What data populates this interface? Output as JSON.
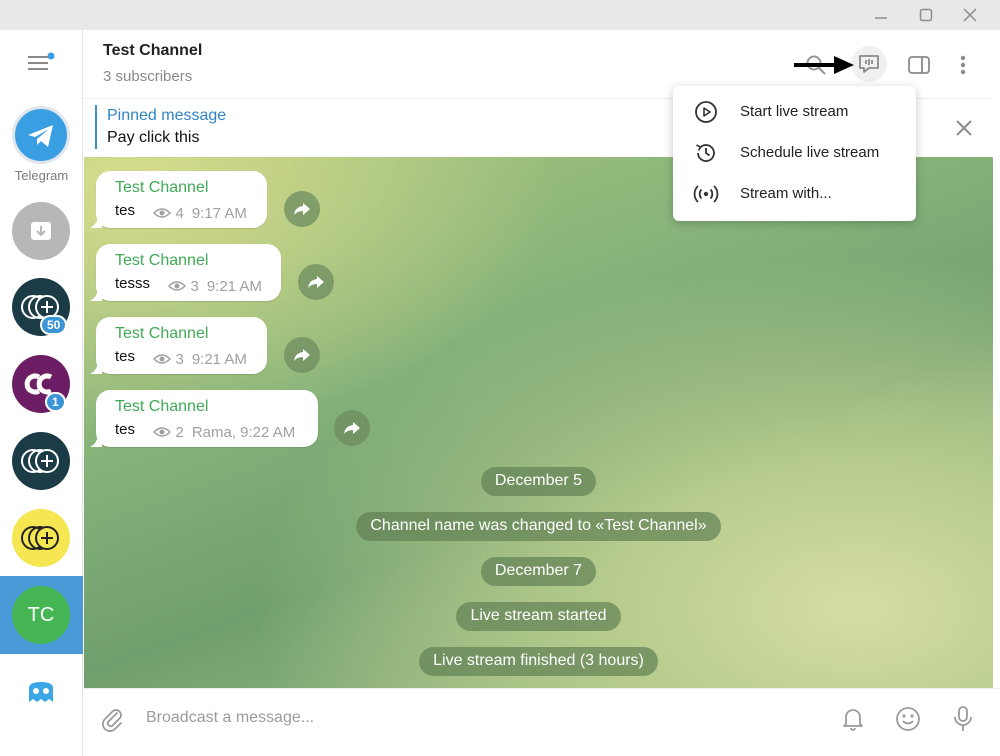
{
  "window": {
    "controls": [
      "minimize-icon",
      "maximize-icon",
      "close-icon"
    ]
  },
  "sidebar": {
    "menu_icon": "hamburger-menu-icon",
    "folders": [
      {
        "label": "Telegram",
        "icon": "telegram-logo",
        "color": "#3a9ee3"
      },
      {
        "icon": "archive-icon",
        "color": "#b7b7b7"
      },
      {
        "icon": "coins-plus-icon",
        "color": "#1b3b47",
        "badge": "50"
      },
      {
        "icon": "cc-logo",
        "color": "#6b1e63",
        "badge": "1"
      },
      {
        "icon": "coins-plus-icon",
        "color": "#1b3b47"
      },
      {
        "icon": "coins-plus-icon",
        "color": "#f5e652"
      },
      {
        "initials": "TC",
        "color": "#46b553",
        "active": true
      },
      {
        "icon": "ghost-icon",
        "color": "#3aa6e6"
      }
    ]
  },
  "header": {
    "title": "Test Channel",
    "subtitle": "3 subscribers",
    "icons": [
      "search-icon",
      "live-stream-icon",
      "sidebar-toggle-icon",
      "more-icon"
    ]
  },
  "pinned": {
    "title": "Pinned message",
    "text": "Pay click this"
  },
  "messages": [
    {
      "author": "Test Channel",
      "text": "tes",
      "views": "4",
      "time": "9:17 AM"
    },
    {
      "author": "Test Channel",
      "text": "tesss",
      "views": "3",
      "time": "9:21 AM"
    },
    {
      "author": "Test Channel",
      "text": "tes",
      "views": "3",
      "time": "9:21 AM"
    },
    {
      "author": "Test Channel",
      "text": "tes",
      "views": "2",
      "time": "Rama, 9:22 AM"
    }
  ],
  "service_messages": [
    "December 5",
    "Channel name was changed to «Test Channel»",
    "December 7",
    "Live stream started",
    "Live stream finished (3 hours)"
  ],
  "popup_menu": {
    "items": [
      {
        "label": "Start live stream",
        "icon": "play-circle-icon"
      },
      {
        "label": "Schedule live stream",
        "icon": "clock-history-icon"
      },
      {
        "label": "Stream with...",
        "icon": "broadcast-icon"
      }
    ]
  },
  "composer": {
    "placeholder": "Broadcast a message...",
    "icons": [
      "attach-icon",
      "bell-icon",
      "emoji-icon",
      "microphone-icon"
    ]
  },
  "colors": {
    "accent": "#3d8fcf",
    "author": "#3faa55",
    "active_folder": "#4a9ad7"
  }
}
